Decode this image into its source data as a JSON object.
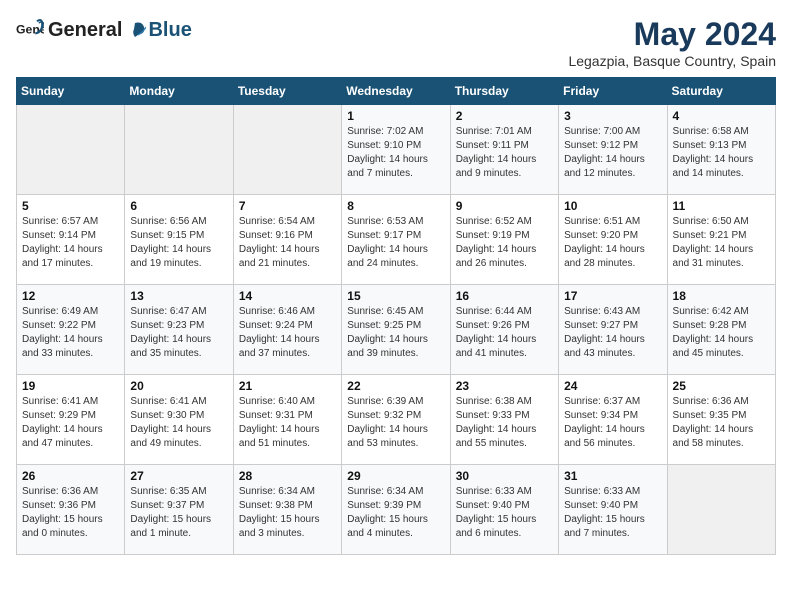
{
  "header": {
    "logo_general": "General",
    "logo_blue": "Blue",
    "month_year": "May 2024",
    "location": "Legazpia, Basque Country, Spain"
  },
  "weekdays": [
    "Sunday",
    "Monday",
    "Tuesday",
    "Wednesday",
    "Thursday",
    "Friday",
    "Saturday"
  ],
  "weeks": [
    [
      {
        "day": "",
        "sunrise": "",
        "sunset": "",
        "daylight": ""
      },
      {
        "day": "",
        "sunrise": "",
        "sunset": "",
        "daylight": ""
      },
      {
        "day": "",
        "sunrise": "",
        "sunset": "",
        "daylight": ""
      },
      {
        "day": "1",
        "sunrise": "Sunrise: 7:02 AM",
        "sunset": "Sunset: 9:10 PM",
        "daylight": "Daylight: 14 hours and 7 minutes."
      },
      {
        "day": "2",
        "sunrise": "Sunrise: 7:01 AM",
        "sunset": "Sunset: 9:11 PM",
        "daylight": "Daylight: 14 hours and 9 minutes."
      },
      {
        "day": "3",
        "sunrise": "Sunrise: 7:00 AM",
        "sunset": "Sunset: 9:12 PM",
        "daylight": "Daylight: 14 hours and 12 minutes."
      },
      {
        "day": "4",
        "sunrise": "Sunrise: 6:58 AM",
        "sunset": "Sunset: 9:13 PM",
        "daylight": "Daylight: 14 hours and 14 minutes."
      }
    ],
    [
      {
        "day": "5",
        "sunrise": "Sunrise: 6:57 AM",
        "sunset": "Sunset: 9:14 PM",
        "daylight": "Daylight: 14 hours and 17 minutes."
      },
      {
        "day": "6",
        "sunrise": "Sunrise: 6:56 AM",
        "sunset": "Sunset: 9:15 PM",
        "daylight": "Daylight: 14 hours and 19 minutes."
      },
      {
        "day": "7",
        "sunrise": "Sunrise: 6:54 AM",
        "sunset": "Sunset: 9:16 PM",
        "daylight": "Daylight: 14 hours and 21 minutes."
      },
      {
        "day": "8",
        "sunrise": "Sunrise: 6:53 AM",
        "sunset": "Sunset: 9:17 PM",
        "daylight": "Daylight: 14 hours and 24 minutes."
      },
      {
        "day": "9",
        "sunrise": "Sunrise: 6:52 AM",
        "sunset": "Sunset: 9:19 PM",
        "daylight": "Daylight: 14 hours and 26 minutes."
      },
      {
        "day": "10",
        "sunrise": "Sunrise: 6:51 AM",
        "sunset": "Sunset: 9:20 PM",
        "daylight": "Daylight: 14 hours and 28 minutes."
      },
      {
        "day": "11",
        "sunrise": "Sunrise: 6:50 AM",
        "sunset": "Sunset: 9:21 PM",
        "daylight": "Daylight: 14 hours and 31 minutes."
      }
    ],
    [
      {
        "day": "12",
        "sunrise": "Sunrise: 6:49 AM",
        "sunset": "Sunset: 9:22 PM",
        "daylight": "Daylight: 14 hours and 33 minutes."
      },
      {
        "day": "13",
        "sunrise": "Sunrise: 6:47 AM",
        "sunset": "Sunset: 9:23 PM",
        "daylight": "Daylight: 14 hours and 35 minutes."
      },
      {
        "day": "14",
        "sunrise": "Sunrise: 6:46 AM",
        "sunset": "Sunset: 9:24 PM",
        "daylight": "Daylight: 14 hours and 37 minutes."
      },
      {
        "day": "15",
        "sunrise": "Sunrise: 6:45 AM",
        "sunset": "Sunset: 9:25 PM",
        "daylight": "Daylight: 14 hours and 39 minutes."
      },
      {
        "day": "16",
        "sunrise": "Sunrise: 6:44 AM",
        "sunset": "Sunset: 9:26 PM",
        "daylight": "Daylight: 14 hours and 41 minutes."
      },
      {
        "day": "17",
        "sunrise": "Sunrise: 6:43 AM",
        "sunset": "Sunset: 9:27 PM",
        "daylight": "Daylight: 14 hours and 43 minutes."
      },
      {
        "day": "18",
        "sunrise": "Sunrise: 6:42 AM",
        "sunset": "Sunset: 9:28 PM",
        "daylight": "Daylight: 14 hours and 45 minutes."
      }
    ],
    [
      {
        "day": "19",
        "sunrise": "Sunrise: 6:41 AM",
        "sunset": "Sunset: 9:29 PM",
        "daylight": "Daylight: 14 hours and 47 minutes."
      },
      {
        "day": "20",
        "sunrise": "Sunrise: 6:41 AM",
        "sunset": "Sunset: 9:30 PM",
        "daylight": "Daylight: 14 hours and 49 minutes."
      },
      {
        "day": "21",
        "sunrise": "Sunrise: 6:40 AM",
        "sunset": "Sunset: 9:31 PM",
        "daylight": "Daylight: 14 hours and 51 minutes."
      },
      {
        "day": "22",
        "sunrise": "Sunrise: 6:39 AM",
        "sunset": "Sunset: 9:32 PM",
        "daylight": "Daylight: 14 hours and 53 minutes."
      },
      {
        "day": "23",
        "sunrise": "Sunrise: 6:38 AM",
        "sunset": "Sunset: 9:33 PM",
        "daylight": "Daylight: 14 hours and 55 minutes."
      },
      {
        "day": "24",
        "sunrise": "Sunrise: 6:37 AM",
        "sunset": "Sunset: 9:34 PM",
        "daylight": "Daylight: 14 hours and 56 minutes."
      },
      {
        "day": "25",
        "sunrise": "Sunrise: 6:36 AM",
        "sunset": "Sunset: 9:35 PM",
        "daylight": "Daylight: 14 hours and 58 minutes."
      }
    ],
    [
      {
        "day": "26",
        "sunrise": "Sunrise: 6:36 AM",
        "sunset": "Sunset: 9:36 PM",
        "daylight": "Daylight: 15 hours and 0 minutes."
      },
      {
        "day": "27",
        "sunrise": "Sunrise: 6:35 AM",
        "sunset": "Sunset: 9:37 PM",
        "daylight": "Daylight: 15 hours and 1 minute."
      },
      {
        "day": "28",
        "sunrise": "Sunrise: 6:34 AM",
        "sunset": "Sunset: 9:38 PM",
        "daylight": "Daylight: 15 hours and 3 minutes."
      },
      {
        "day": "29",
        "sunrise": "Sunrise: 6:34 AM",
        "sunset": "Sunset: 9:39 PM",
        "daylight": "Daylight: 15 hours and 4 minutes."
      },
      {
        "day": "30",
        "sunrise": "Sunrise: 6:33 AM",
        "sunset": "Sunset: 9:40 PM",
        "daylight": "Daylight: 15 hours and 6 minutes."
      },
      {
        "day": "31",
        "sunrise": "Sunrise: 6:33 AM",
        "sunset": "Sunset: 9:40 PM",
        "daylight": "Daylight: 15 hours and 7 minutes."
      },
      {
        "day": "",
        "sunrise": "",
        "sunset": "",
        "daylight": ""
      }
    ]
  ]
}
